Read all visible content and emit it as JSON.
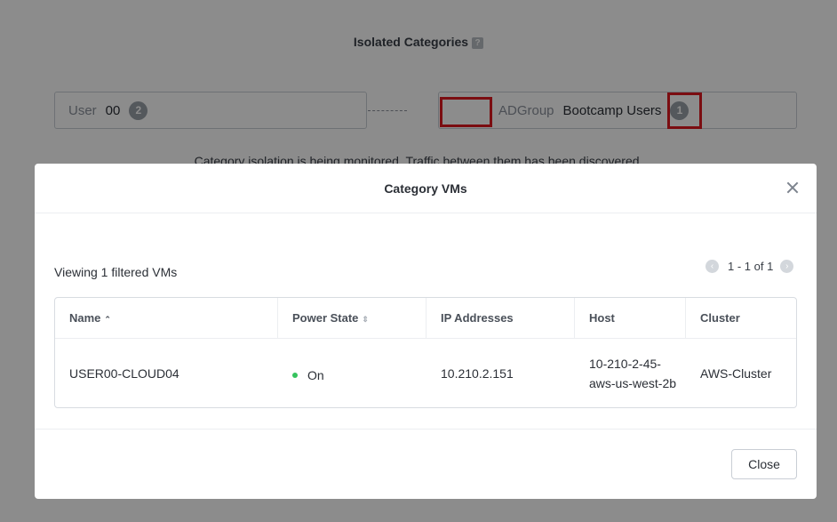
{
  "background": {
    "title": "Isolated Categories",
    "help_icon": "?",
    "left_category": {
      "key": "User",
      "value": "00",
      "count": "2"
    },
    "right_category": {
      "key": "ADGroup",
      "value": "Bootcamp Users",
      "count": "1"
    },
    "message": "Category isolation is being monitored. Traffic between them has been discovered."
  },
  "modal": {
    "title": "Category VMs",
    "viewing_text": "Viewing 1 filtered VMs",
    "pagination": {
      "text": "1 - 1 of 1",
      "prev_icon": "‹",
      "next_icon": "›"
    },
    "table": {
      "columns": [
        "Name",
        "Power State",
        "IP Addresses",
        "Host",
        "Cluster"
      ],
      "sort_icons": {
        "name": "⌃",
        "power": "⇕"
      },
      "rows": [
        {
          "name": "USER00-CLOUD04",
          "power_state": "On",
          "ip": "10.210.2.151",
          "host": "10-210-2-45-aws-us-west-2b",
          "cluster": "AWS-Cluster"
        }
      ]
    },
    "close_button": "Close"
  },
  "colors": {
    "highlight": "#e0191f",
    "status_on": "#36c35e",
    "overlay": "rgba(0,0,0,0.45)"
  }
}
